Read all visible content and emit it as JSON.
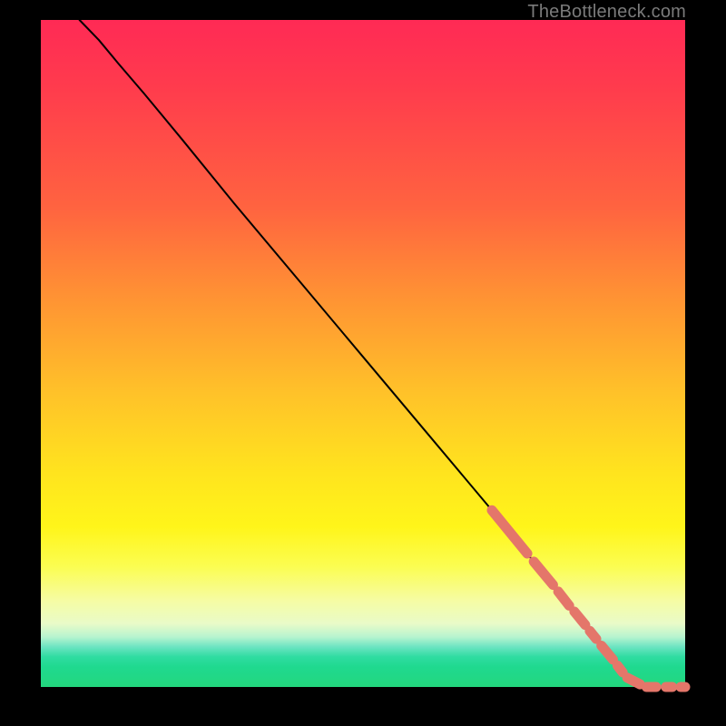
{
  "watermark": "TheBottleneck.com",
  "colors": {
    "background": "#000000",
    "curve": "#000000",
    "markers": "#e4766a",
    "watermark_text": "#7b7b7b"
  },
  "chart_data": {
    "type": "line",
    "title": "",
    "xlabel": "",
    "ylabel": "",
    "xlim": [
      0,
      100
    ],
    "ylim": [
      0,
      100
    ],
    "grid": false,
    "legend": false,
    "curve": {
      "comment": "Main black curve; starts top-left, bows slightly, descends to bottom-right floor.",
      "x": [
        6,
        9,
        12,
        16,
        22,
        30,
        40,
        50,
        60,
        70,
        78,
        84,
        88,
        90,
        92,
        94,
        96,
        98,
        100
      ],
      "y": [
        100,
        97,
        93.5,
        89,
        82,
        72.5,
        61,
        49.5,
        38,
        26.5,
        17,
        10,
        5,
        2.5,
        1,
        0.3,
        0,
        0,
        0
      ]
    },
    "markers": {
      "comment": "Thick coral/salmon dashed segments overlaying the lower-right portion of the curve and along the x-axis tail.",
      "segments": [
        {
          "x": [
            70.0,
            75.5
          ],
          "y": [
            26.5,
            20.0
          ]
        },
        {
          "x": [
            76.5,
            79.5
          ],
          "y": [
            18.8,
            15.3
          ]
        },
        {
          "x": [
            80.3,
            82.0
          ],
          "y": [
            14.3,
            12.2
          ]
        },
        {
          "x": [
            82.8,
            84.5
          ],
          "y": [
            11.3,
            9.3
          ]
        },
        {
          "x": [
            85.2,
            86.2
          ],
          "y": [
            8.4,
            7.2
          ]
        },
        {
          "x": [
            87.0,
            88.8
          ],
          "y": [
            6.2,
            4.1
          ]
        },
        {
          "x": [
            89.5,
            90.3
          ],
          "y": [
            3.2,
            2.2
          ]
        },
        {
          "x": [
            91.0,
            93.0
          ],
          "y": [
            1.4,
            0.4
          ]
        },
        {
          "x": [
            94.0,
            95.5
          ],
          "y": [
            0.0,
            0.0
          ]
        },
        {
          "x": [
            97.0,
            98.0
          ],
          "y": [
            0.0,
            0.0
          ]
        },
        {
          "x": [
            99.3,
            100.0
          ],
          "y": [
            0.0,
            0.0
          ]
        }
      ]
    }
  }
}
